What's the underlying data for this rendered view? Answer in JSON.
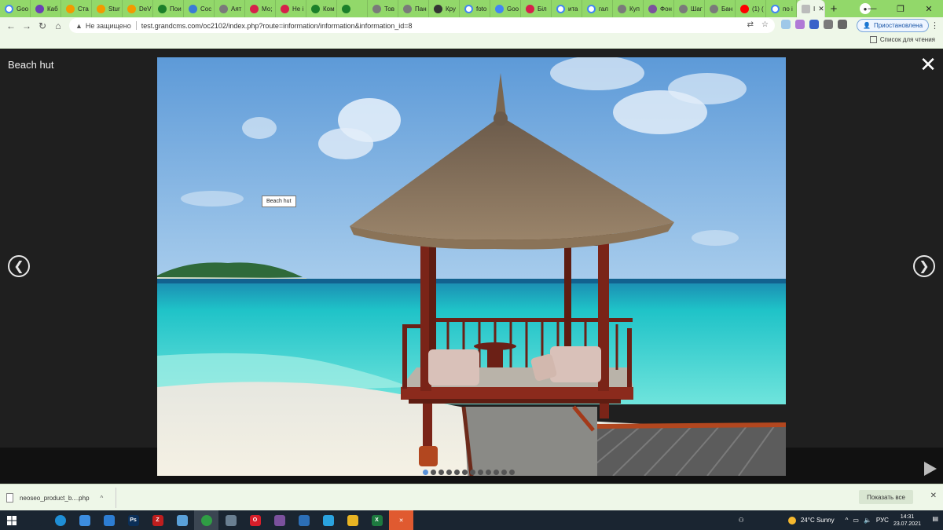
{
  "browser": {
    "tabs": [
      {
        "label": "Goo",
        "icon": "google-icon",
        "color": "#ffffff"
      },
      {
        "label": "Каб",
        "icon": "cabinet-icon",
        "color": "#6a3fb5"
      },
      {
        "label": "Ста",
        "icon": "h-icon",
        "color": "#f29a00"
      },
      {
        "label": "Stur",
        "icon": "h-icon",
        "color": "#f29a00"
      },
      {
        "label": "DeV",
        "icon": "h-icon",
        "color": "#f29a00"
      },
      {
        "label": "Пои",
        "icon": "pickaxe-icon",
        "color": "#1b7f2a"
      },
      {
        "label": "Сос",
        "icon": "chart-icon",
        "color": "#3a7bd5"
      },
      {
        "label": "Аят",
        "icon": "dot-icon",
        "color": "#7a7a7a"
      },
      {
        "label": "Мо;",
        "icon": "ns-icon",
        "color": "#d6204b"
      },
      {
        "label": "Не і",
        "icon": "ns-icon",
        "color": "#d6204b"
      },
      {
        "label": "Ком",
        "icon": "pickaxe-icon",
        "color": "#1b7f2a"
      },
      {
        "label": "",
        "icon": "check-icon",
        "color": "#1b7f2a"
      },
      {
        "label": "Тов",
        "icon": "dot-icon",
        "color": "#7a7a7a"
      },
      {
        "label": "Пан",
        "icon": "dot-icon",
        "color": "#7a7a7a"
      },
      {
        "label": "Кру",
        "icon": "pickaxe-icon",
        "color": "#333333"
      },
      {
        "label": "foto",
        "icon": "google-icon",
        "color": "#ffffff"
      },
      {
        "label": "Goo",
        "icon": "photos-icon",
        "color": "#4285f4"
      },
      {
        "label": "Біл",
        "icon": "opera-icon",
        "color": "#d6204b"
      },
      {
        "label": "ита",
        "icon": "google-icon",
        "color": "#ffffff"
      },
      {
        "label": "гал",
        "icon": "google-icon",
        "color": "#ffffff"
      },
      {
        "label": "Куп",
        "icon": "dot-icon",
        "color": "#7a7a7a"
      },
      {
        "label": "Фон",
        "icon": "viber-icon",
        "color": "#7b519d"
      },
      {
        "label": "Шаг",
        "icon": "dot-icon",
        "color": "#7a7a7a"
      },
      {
        "label": "Бан",
        "icon": "dot-icon",
        "color": "#7a7a7a"
      },
      {
        "label": "(1) (",
        "icon": "youtube-icon",
        "color": "#ff0000"
      },
      {
        "label": "по і",
        "icon": "google-icon",
        "color": "#ffffff"
      }
    ],
    "active_tab_label": "I",
    "new_tab_label": "+",
    "security_label": "Не защищено",
    "url": "test.grandcms.com/oc2102/index.php?route=information/information&information_id=8",
    "paused_label": "Приостановлена",
    "reading_list_label": "Список для чтения"
  },
  "lightbox": {
    "title": "Beach hut",
    "tooltip": "Beach hut",
    "close_symbol": "✕",
    "prev_symbol": "❮",
    "next_symbol": "❯",
    "slide_count": 12,
    "active_slide": 0
  },
  "downloads": {
    "file_name": "neoseo_product_b....php",
    "show_all_label": "Показать все"
  },
  "taskbar": {
    "apps": [
      {
        "name": "task-view-icon",
        "color": "#1a2531",
        "glyph": ""
      },
      {
        "name": "edge-icon",
        "color": "#1f8fd6",
        "glyph": ""
      },
      {
        "name": "download-app-icon",
        "color": "#3c8de0",
        "glyph": ""
      },
      {
        "name": "mail-icon",
        "color": "#2d7dd2",
        "glyph": ""
      },
      {
        "name": "photoshop-icon",
        "color": "#0b2f58",
        "glyph": "Ps"
      },
      {
        "name": "filezilla-icon",
        "color": "#bf1e1e",
        "glyph": "Z"
      },
      {
        "name": "notepad-icon",
        "color": "#5aa0d8",
        "glyph": ""
      },
      {
        "name": "chrome-icon",
        "color": "#2f9e44",
        "glyph": ""
      },
      {
        "name": "utility-icon",
        "color": "#6a7f91",
        "glyph": ""
      },
      {
        "name": "opera-icon",
        "color": "#d81e2a",
        "glyph": "O"
      },
      {
        "name": "viber-icon",
        "color": "#7b519d",
        "glyph": ""
      },
      {
        "name": "photos-icon",
        "color": "#2c6fb7",
        "glyph": ""
      },
      {
        "name": "telegram-icon",
        "color": "#2aa3df",
        "glyph": ""
      },
      {
        "name": "explorer-icon",
        "color": "#e8b423",
        "glyph": ""
      },
      {
        "name": "excel-icon",
        "color": "#1d7a3f",
        "glyph": "X"
      },
      {
        "name": "xmind-icon",
        "color": "#e05a30",
        "glyph": "✕"
      }
    ],
    "weather": "24°C  Sunny",
    "lang": "РУС",
    "time": "14:31",
    "date": "23.07.2021"
  },
  "colors": {
    "tab_strip": "#92d86a",
    "toolbar": "#eef7e8",
    "lightbox_bg": "#1f1f1f",
    "taskbar": "#1a2531"
  }
}
